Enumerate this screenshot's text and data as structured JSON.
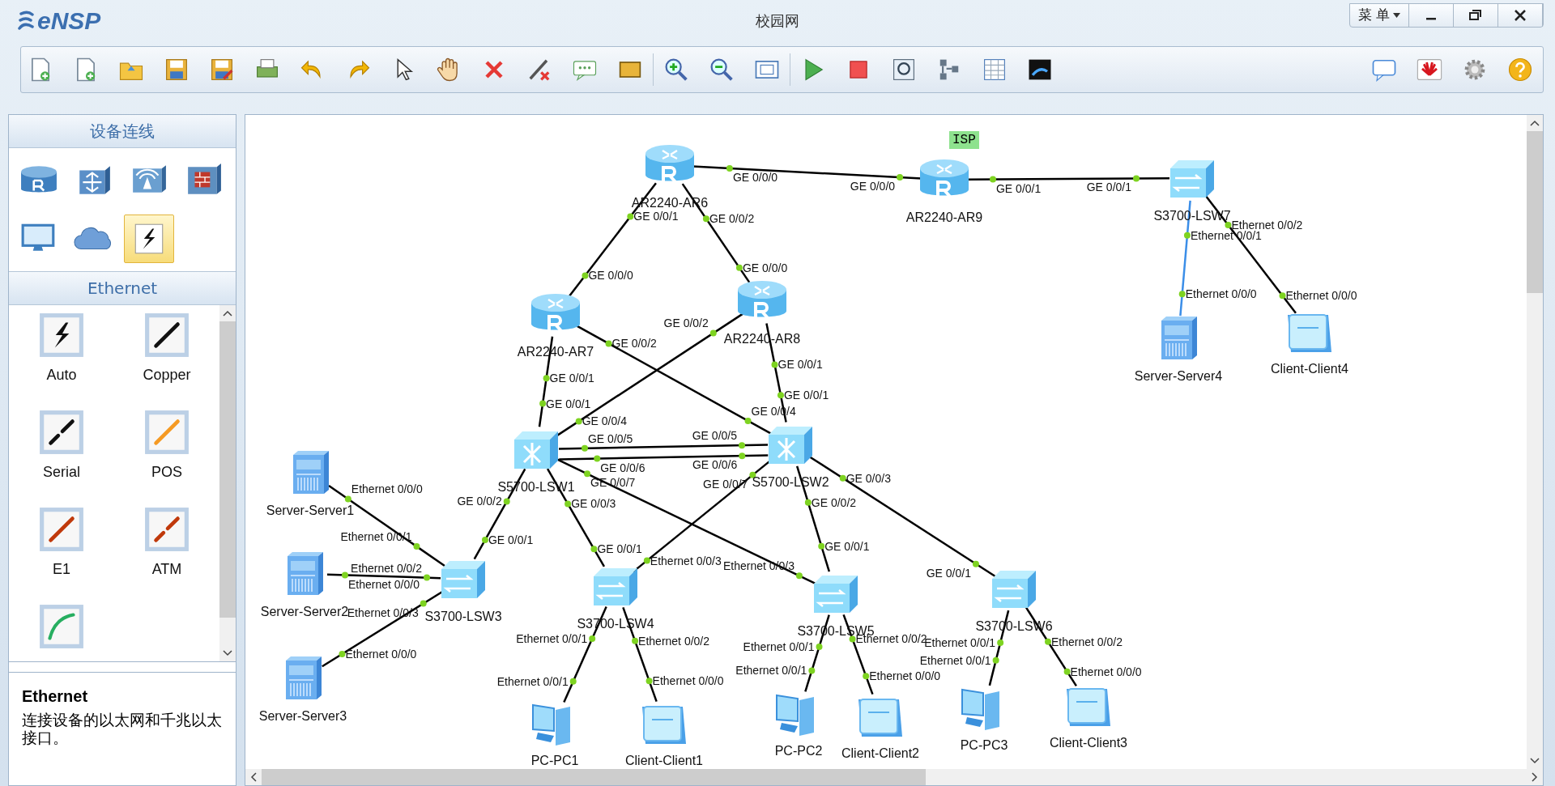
{
  "window": {
    "logo": "eNSP",
    "title": "校园网",
    "menu": "菜 单"
  },
  "device_panel": {
    "title": "设备连线",
    "categories": [
      {
        "kind": "router",
        "selected": false
      },
      {
        "kind": "switch",
        "selected": false
      },
      {
        "kind": "wireless",
        "selected": false
      },
      {
        "kind": "firewall",
        "selected": false
      },
      {
        "kind": "terminal",
        "selected": false
      },
      {
        "kind": "cloud",
        "selected": false
      },
      {
        "kind": "cable",
        "selected": true
      }
    ]
  },
  "cable_panel": {
    "title": "Ethernet",
    "cables": [
      {
        "kind": "auto",
        "label": "Auto"
      },
      {
        "kind": "copper",
        "label": "Copper"
      },
      {
        "kind": "serial",
        "label": "Serial"
      },
      {
        "kind": "pos",
        "label": "POS"
      },
      {
        "kind": "e1",
        "label": "E1"
      },
      {
        "kind": "atm",
        "label": "ATM"
      },
      {
        "kind": "ctl"
      }
    ]
  },
  "description": {
    "title": "Ethernet",
    "text": "连接设备的以太网和千兆以太接口。"
  },
  "topology": {
    "nodes": [
      {
        "kind": "router",
        "name": "AR2240-AR6"
      },
      {
        "kind": "router",
        "name": "AR2240-AR9",
        "tag": "ISP"
      },
      {
        "kind": "switch",
        "name": "S3700-LSW7"
      },
      {
        "kind": "router",
        "name": "AR2240-AR7"
      },
      {
        "kind": "router",
        "name": "AR2240-AR8"
      },
      {
        "kind": "core",
        "name": "S5700-LSW1"
      },
      {
        "kind": "core",
        "name": "S5700-LSW2"
      },
      {
        "kind": "server",
        "name": "Server-Server1"
      },
      {
        "kind": "server",
        "name": "Server-Server2"
      },
      {
        "kind": "server",
        "name": "Server-Server3"
      },
      {
        "kind": "switch",
        "name": "S3700-LSW3"
      },
      {
        "kind": "switch",
        "name": "S3700-LSW4"
      },
      {
        "kind": "switch",
        "name": "S3700-LSW5"
      },
      {
        "kind": "switch",
        "name": "S3700-LSW6"
      },
      {
        "kind": "server",
        "name": "Server-Server4"
      },
      {
        "kind": "client",
        "name": "Client-Client4"
      },
      {
        "kind": "pc",
        "name": "PC-PC1"
      },
      {
        "kind": "client",
        "name": "Client-Client1"
      },
      {
        "kind": "pc",
        "name": "PC-PC2"
      },
      {
        "kind": "client",
        "name": "Client-Client2"
      },
      {
        "kind": "pc",
        "name": "PC-PC3"
      },
      {
        "kind": "client",
        "name": "Client-Client3"
      }
    ],
    "links": [
      {
        "port_a": "GE 0/0/0",
        "port_b": "GE 0/0/0",
        "color": "#000000"
      },
      {
        "port_a": "GE 0/0/1",
        "port_b": "GE 0/0/1",
        "color": "#000000"
      },
      {
        "port_a": "GE 0/0/1",
        "port_b": "GE 0/0/0",
        "color": "#000000"
      },
      {
        "port_a": "GE 0/0/2",
        "port_b": "GE 0/0/0",
        "color": "#000000"
      },
      {
        "port_a": "Ethernet 0/0/1",
        "port_b": "Ethernet 0/0/0",
        "color": "#3b8ee8"
      },
      {
        "port_a": "Ethernet 0/0/2",
        "port_b": "Ethernet 0/0/0",
        "color": "#000000"
      },
      {
        "port_a": "GE 0/0/1",
        "port_b": "GE 0/0/1",
        "color": "#000000"
      },
      {
        "port_a": "GE 0/0/2",
        "port_b": "GE 0/0/4",
        "color": "#000000"
      },
      {
        "port_a": "GE 0/0/2",
        "port_b": "GE 0/0/4",
        "color": "#000000"
      },
      {
        "port_a": "GE 0/0/1",
        "port_b": "GE 0/0/1",
        "color": "#000000"
      },
      {
        "port_a": "GE 0/0/5",
        "port_b": "GE 0/0/5",
        "color": "#000000"
      },
      {
        "port_a": "GE 0/0/6",
        "port_b": "GE 0/0/6",
        "color": "#000000"
      },
      {
        "port_a": "Ethernet 0/0/1",
        "port_b": "Ethernet 0/0/0",
        "color": "#000000"
      },
      {
        "port_a": "GE 0/0/2",
        "port_b": "GE 0/0/1",
        "color": "#000000"
      },
      {
        "port_a": "GE 0/0/7",
        "port_b": "Ethernet 0/0/3",
        "color": "#000000"
      },
      {
        "port_a": "GE 0/0/3",
        "port_b": "GE 0/0/1",
        "color": "#000000"
      },
      {
        "port_a": "GE 0/0/7",
        "port_b": "Ethernet 0/0/3",
        "color": "#000000"
      },
      {
        "port_a": "GE 0/0/2",
        "port_b": "GE 0/0/1",
        "color": "#000000"
      },
      {
        "port_a": "GE 0/0/3",
        "port_b": "GE 0/0/1",
        "color": "#000000"
      },
      {
        "port_a": "Ethernet 0/0/2",
        "port_b": "Ethernet 0/0/0",
        "color": "#000000"
      },
      {
        "port_a": "Ethernet 0/0/3",
        "port_b": "Ethernet 0/0/0",
        "color": "#000000"
      },
      {
        "port_a": "Ethernet 0/0/1",
        "port_b": "Ethernet 0/0/1",
        "color": "#000000"
      },
      {
        "port_a": "Ethernet 0/0/2",
        "port_b": "Ethernet 0/0/0",
        "color": "#000000"
      },
      {
        "port_a": "Ethernet 0/0/1",
        "port_b": "Ethernet 0/0/1",
        "color": "#000000"
      },
      {
        "port_a": "Ethernet 0/0/2",
        "port_b": "Ethernet 0/0/0",
        "color": "#000000"
      },
      {
        "port_a": "Ethernet 0/0/1",
        "port_b": "Ethernet 0/0/1",
        "color": "#000000"
      },
      {
        "port_a": "Ethernet 0/0/2",
        "port_b": "Ethernet 0/0/0",
        "color": "#000000"
      }
    ]
  }
}
